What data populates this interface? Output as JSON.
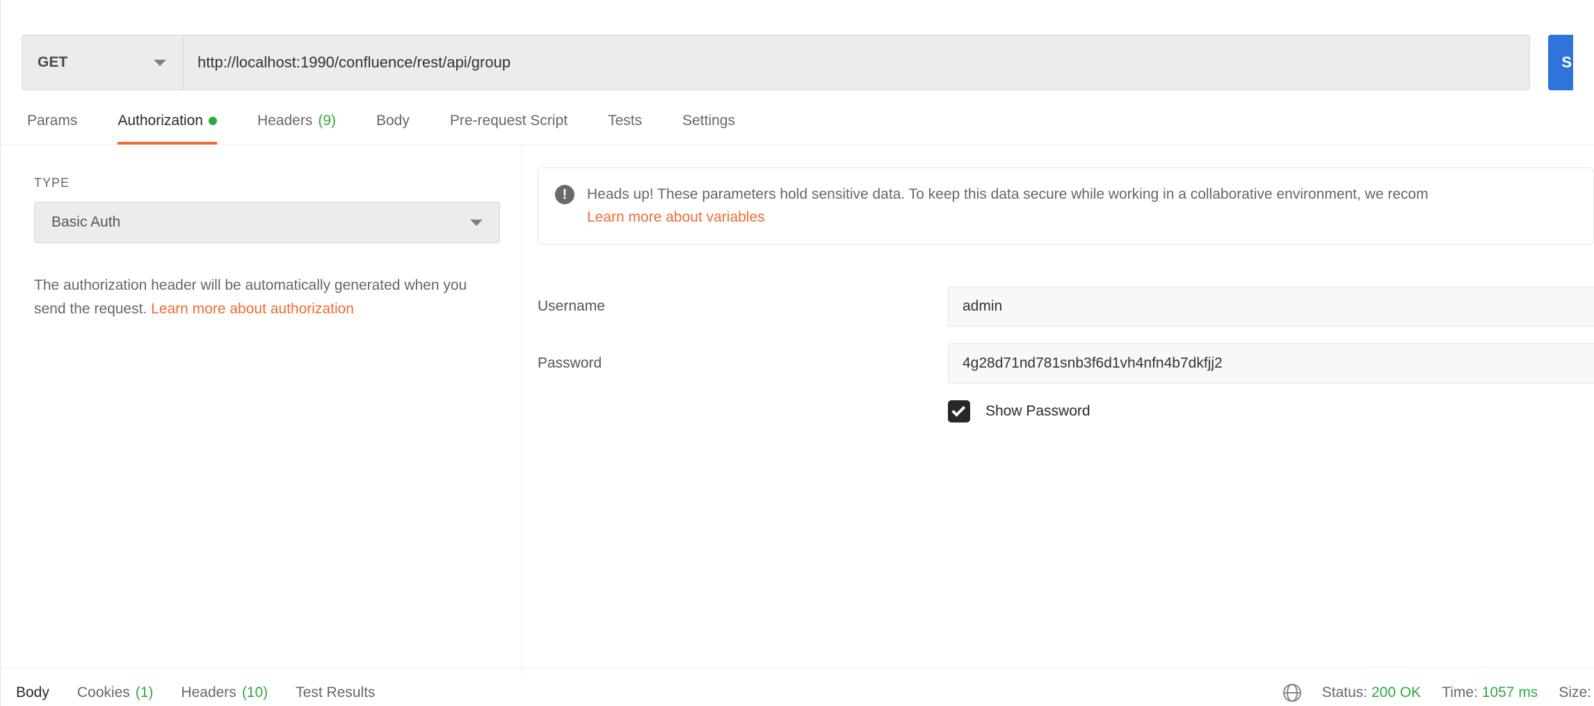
{
  "request": {
    "method": "GET",
    "url": "http://localhost:1990/confluence/rest/api/group",
    "send_label": "S"
  },
  "tabs": {
    "params": "Params",
    "authorization": "Authorization",
    "headers": "Headers",
    "headers_count": "(9)",
    "body": "Body",
    "prerequest": "Pre-request Script",
    "tests": "Tests",
    "settings": "Settings"
  },
  "auth": {
    "type_label": "TYPE",
    "type_value": "Basic Auth",
    "description_1": "The authorization header will be automatically generated when you send the request. ",
    "learn_link": "Learn more about authorization",
    "notice_text": "Heads up! These parameters hold sensitive data. To keep this data secure while working in a collaborative environment, we recom",
    "notice_link": "Learn more about variables",
    "username_label": "Username",
    "username_value": "admin",
    "password_label": "Password",
    "password_value": "4g28d71nd781snb3f6d1vh4nfn4b7dkfjj2",
    "show_password_label": "Show Password"
  },
  "response": {
    "tabs": {
      "body": "Body",
      "cookies": "Cookies",
      "cookies_count": "(1)",
      "headers": "Headers",
      "headers_count": "(10)",
      "test_results": "Test Results"
    },
    "status_label": "Status:",
    "status_value": "200 OK",
    "time_label": "Time:",
    "time_value": "1057 ms",
    "size_label": "Size:"
  }
}
